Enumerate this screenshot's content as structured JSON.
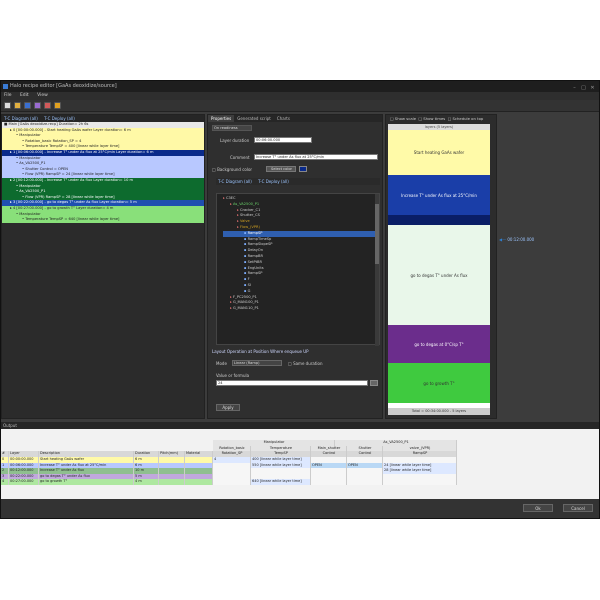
{
  "window": {
    "title": "Halo recipe editor [GaAs deoxidize/source]"
  },
  "menu": [
    "File",
    "Edit",
    "View"
  ],
  "left_panel": {
    "tabs": [
      "T-C Diagram (all)",
      "T-C Deploy (all)"
    ],
    "rows": [
      {
        "text": "Main [GaAs deoxidize.recp] Duration= 2h 6s",
        "color": "#e8e8e8",
        "indent": 0
      },
      {
        "text": "0 [00:00:00.000] - Start heating GaAs wafer Layer duration= 6 m",
        "color": "#fff9a6",
        "indent": 1
      },
      {
        "text": "Manipulator",
        "color": "#fff9a6",
        "indent": 2
      },
      {
        "text": "Rotation_basic Rotation_SP = 4",
        "color": "#fff9a6",
        "indent": 3
      },
      {
        "text": "Temperature TempSP = 400 [linear while layer time]",
        "color": "#fff9a6",
        "indent": 3
      },
      {
        "text": "1 [00:06:00.000] - Increase T° under As flux at 25°C/min Layer duration= 6 m",
        "color": "#0a2a8a",
        "indent": 1
      },
      {
        "text": "Manipulator",
        "color": "#b8c8ff",
        "indent": 2
      },
      {
        "text": "As_VA2500_P1",
        "color": "#b8c8ff",
        "indent": 2
      },
      {
        "text": "Shutter Control = OPEN",
        "color": "#b8c8ff",
        "indent": 3
      },
      {
        "text": "Flow (VPR) RampSP = 24 [linear while layer time]",
        "color": "#b8c8ff",
        "indent": 3
      },
      {
        "text": "2 [00:12:00.000] - Increase T° under As flux Layer duration= 10 m",
        "color": "#0d6b2e",
        "indent": 1
      },
      {
        "text": "Manipulator",
        "color": "#0d6b2e",
        "indent": 2
      },
      {
        "text": "As_VA2500_P1",
        "color": "#0d6b2e",
        "indent": 2
      },
      {
        "text": "Flow (VPR) RampSP = 28 [linear while layer time]",
        "color": "#0d6b2e",
        "indent": 3
      },
      {
        "text": "3 [00:22:00.000] - go to degas T° under As flux Layer duration= 5 m",
        "color": "#1f4fb0",
        "indent": 1
      },
      {
        "text": "4 [00:27:00.000] - go to growth T° Layer duration= 4 m",
        "color": "#89e07a",
        "indent": 1
      },
      {
        "text": "Manipulator",
        "color": "#89e07a",
        "indent": 2
      },
      {
        "text": "Temperature TempSP = 640 [linear while layer time]",
        "color": "#89e07a",
        "indent": 3
      }
    ]
  },
  "middle_panel": {
    "tabs": [
      "Properties",
      "Generated script",
      "Charts"
    ],
    "layer_type": "On readiness",
    "layer_duration_label": "Layer duration",
    "layer_duration": "00:06:00.000",
    "comment_label": "Comment",
    "comment": "Increase T° under As flux at 25°C/min",
    "background_label": "Background color",
    "select_color_label": "Select color",
    "inner_tabs": [
      "T-C Diagram (all)",
      "T-C Deploy (all)"
    ],
    "tree": [
      "C3EC",
      "As_VA2500_P1",
      "Cracker_C1",
      "Shutter_CS",
      "Valve",
      "Flow_(VPR)",
      "RampSP",
      "RampTimeSp",
      "RampSlopeSP",
      "DelayOn",
      "RampBR",
      "SetPtBR",
      "EngUnits",
      "RampSP",
      "F",
      "SI",
      "G",
      "F_PC2500_P1",
      "G_MAN100_P1",
      "G_MAN110_P1"
    ],
    "section_label": "Layout Operation at Position Where enqueue UP",
    "mode_label": "Mode",
    "mode_value": "Linear (Ramp)",
    "same_duration_label": "Same duration",
    "value_formula_label": "Value or formula",
    "value_formula": "24",
    "apply_label": "Apply"
  },
  "right_panel": {
    "checkboxes": [
      "Show scale",
      "Show times",
      "Schedule on top"
    ],
    "header": "layers (5 layers)",
    "blocks": [
      {
        "label": "Start heating GaAs wafer",
        "color": "#fffaa8",
        "h": 45
      },
      {
        "label": "Increase T° under As flux at 25°C/min",
        "color": "#1a3ea8",
        "h": 40
      },
      {
        "label": "",
        "color": "#0a1e66",
        "h": 10
      },
      {
        "label": "go to degas T° under As flux",
        "color": "#e9f7ea",
        "h": 100
      },
      {
        "label": "go to degas at 0°C/sp T°",
        "color": "#6b2d8c",
        "h": 38
      },
      {
        "label": "go to growth T°",
        "color": "#3fca3f",
        "h": 40
      }
    ],
    "footer": "Total = 00:34:00.000 - 5 layers",
    "marker_time": "00:12:00.000"
  },
  "output": {
    "title": "Output",
    "left_headers": [
      "#",
      "Layer",
      "Description",
      "Duration",
      "Pitch(mm)",
      "Material"
    ],
    "rows": [
      {
        "n": "0",
        "layer": "00:00:00.000",
        "desc": "Start heating GaAs wafer",
        "dur": "6 m",
        "color": "#fffaa8"
      },
      {
        "n": "1",
        "layer": "00:06:00.000",
        "desc": "Increase T° under As flux at 25°C/min",
        "dur": "6 m",
        "color": "#b8c8ff"
      },
      {
        "n": "2",
        "layer": "00:12:00.000",
        "desc": "Increase T° under As flux",
        "dur": "10 m",
        "color": "#8fbf8f"
      },
      {
        "n": "3",
        "layer": "00:22:00.000",
        "desc": "go to degas T° under As flux",
        "dur": "5 m",
        "color": "#c0a8dd"
      },
      {
        "n": "4",
        "layer": "00:27:00.000",
        "desc": "go to growth T°",
        "dur": "4 m",
        "color": "#aee8a0"
      }
    ],
    "right_groups": [
      "Manipulator",
      "As_VA2500_P1"
    ],
    "right_headers": [
      "Rotation_basic",
      "Temperature",
      "Main_shutter",
      "Shutter",
      "valve_(VPR)"
    ],
    "right_sub": [
      "Rotation_SP",
      "TempSP",
      "Control",
      "Control",
      "RampSP"
    ],
    "right_rows": [
      [
        "4",
        "400 [linear while layer time]",
        "",
        "",
        ""
      ],
      [
        "",
        "550 [linear while layer time]",
        "OPEN",
        "OPEN",
        "24 [linear while layer time]"
      ],
      [
        "",
        "",
        "",
        "",
        "28 [linear while layer time]"
      ],
      [
        "",
        "",
        "",
        "",
        ""
      ],
      [
        "",
        "640 [linear while layer time]",
        "",
        "",
        ""
      ]
    ]
  },
  "footer": {
    "ok_label": "Ok",
    "cancel_label": "Cancel"
  }
}
